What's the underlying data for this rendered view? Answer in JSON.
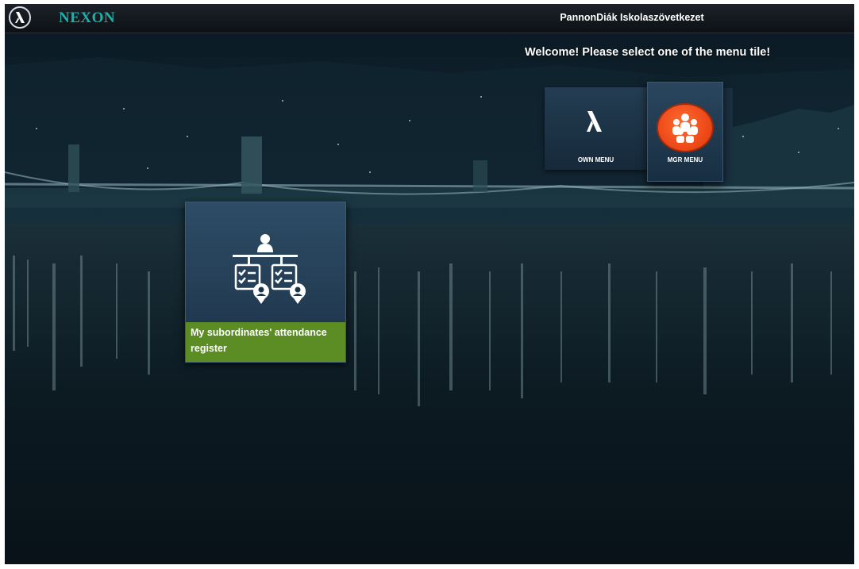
{
  "header": {
    "brand": "NEXON",
    "company": "PannonDiák Iskolaszövetkezet",
    "logo_icon": "nexon-lambda-icon"
  },
  "main": {
    "welcome": "Welcome! Please select one of the menu tile!",
    "menu_tiles": [
      {
        "label": "OWN MENU",
        "icon": "nexon-lambda-icon"
      },
      {
        "label": "MGR MENU",
        "icon": "group-people-icon",
        "icon_color": "#e8400f"
      }
    ],
    "app_tiles": [
      {
        "label": "My subordinates' attendance register",
        "icon": "subordinates-attendance-icon",
        "label_bg": "#5c8c24"
      }
    ]
  },
  "colors": {
    "brand": "#1fb0a8",
    "topbar": "#14191e",
    "tile": "#213a50"
  }
}
